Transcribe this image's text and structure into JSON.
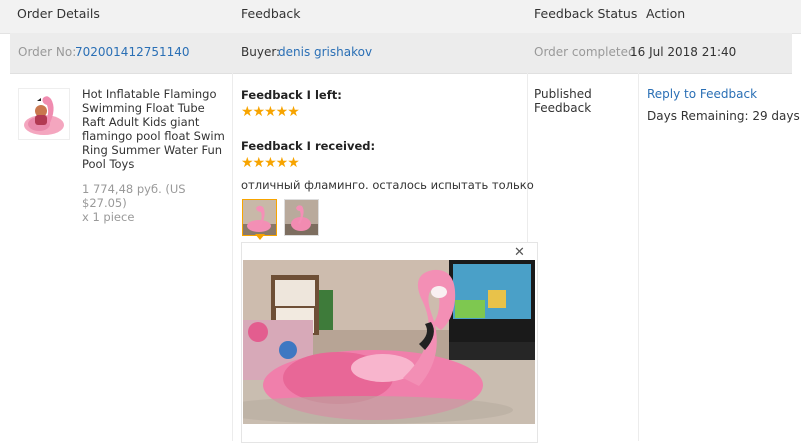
{
  "header": {
    "col_order": "Order Details",
    "col_feedback": "Feedback",
    "col_status": "Feedback Status",
    "col_action": "Action"
  },
  "order": {
    "no_label": "Order No:",
    "no_value": "702001412751140",
    "buyer_label": "Buyer:",
    "buyer_name": "denis grishakov",
    "status_label": "Order completed",
    "date": "16 Jul 2018 21:40"
  },
  "product": {
    "title": "Hot Inflatable Flamingo Swimming Float Tube Raft Adult Kids giant flamingo pool float Swim Ring Summer Water Fun Pool Toys",
    "price": "1 774,48 руб. (US $27.05)",
    "qty": "x 1 piece"
  },
  "feedback": {
    "left_label": "Feedback I left:",
    "left_stars": "★★★★★",
    "left_rating": 5,
    "received_label": "Feedback I received:",
    "received_stars": "★★★★★",
    "received_rating": 5,
    "comment": "отличный фламинго. осталось испытать только",
    "close_icon": "✕"
  },
  "status": {
    "line1": "Published",
    "line2": "Feedback"
  },
  "action": {
    "reply_label": "Reply to Feedback",
    "days_label": "Days Remaining: 29 days"
  },
  "colors": {
    "link": "#2a6fb5",
    "star": "#f7a400",
    "header_bg": "#f2f2f2"
  }
}
